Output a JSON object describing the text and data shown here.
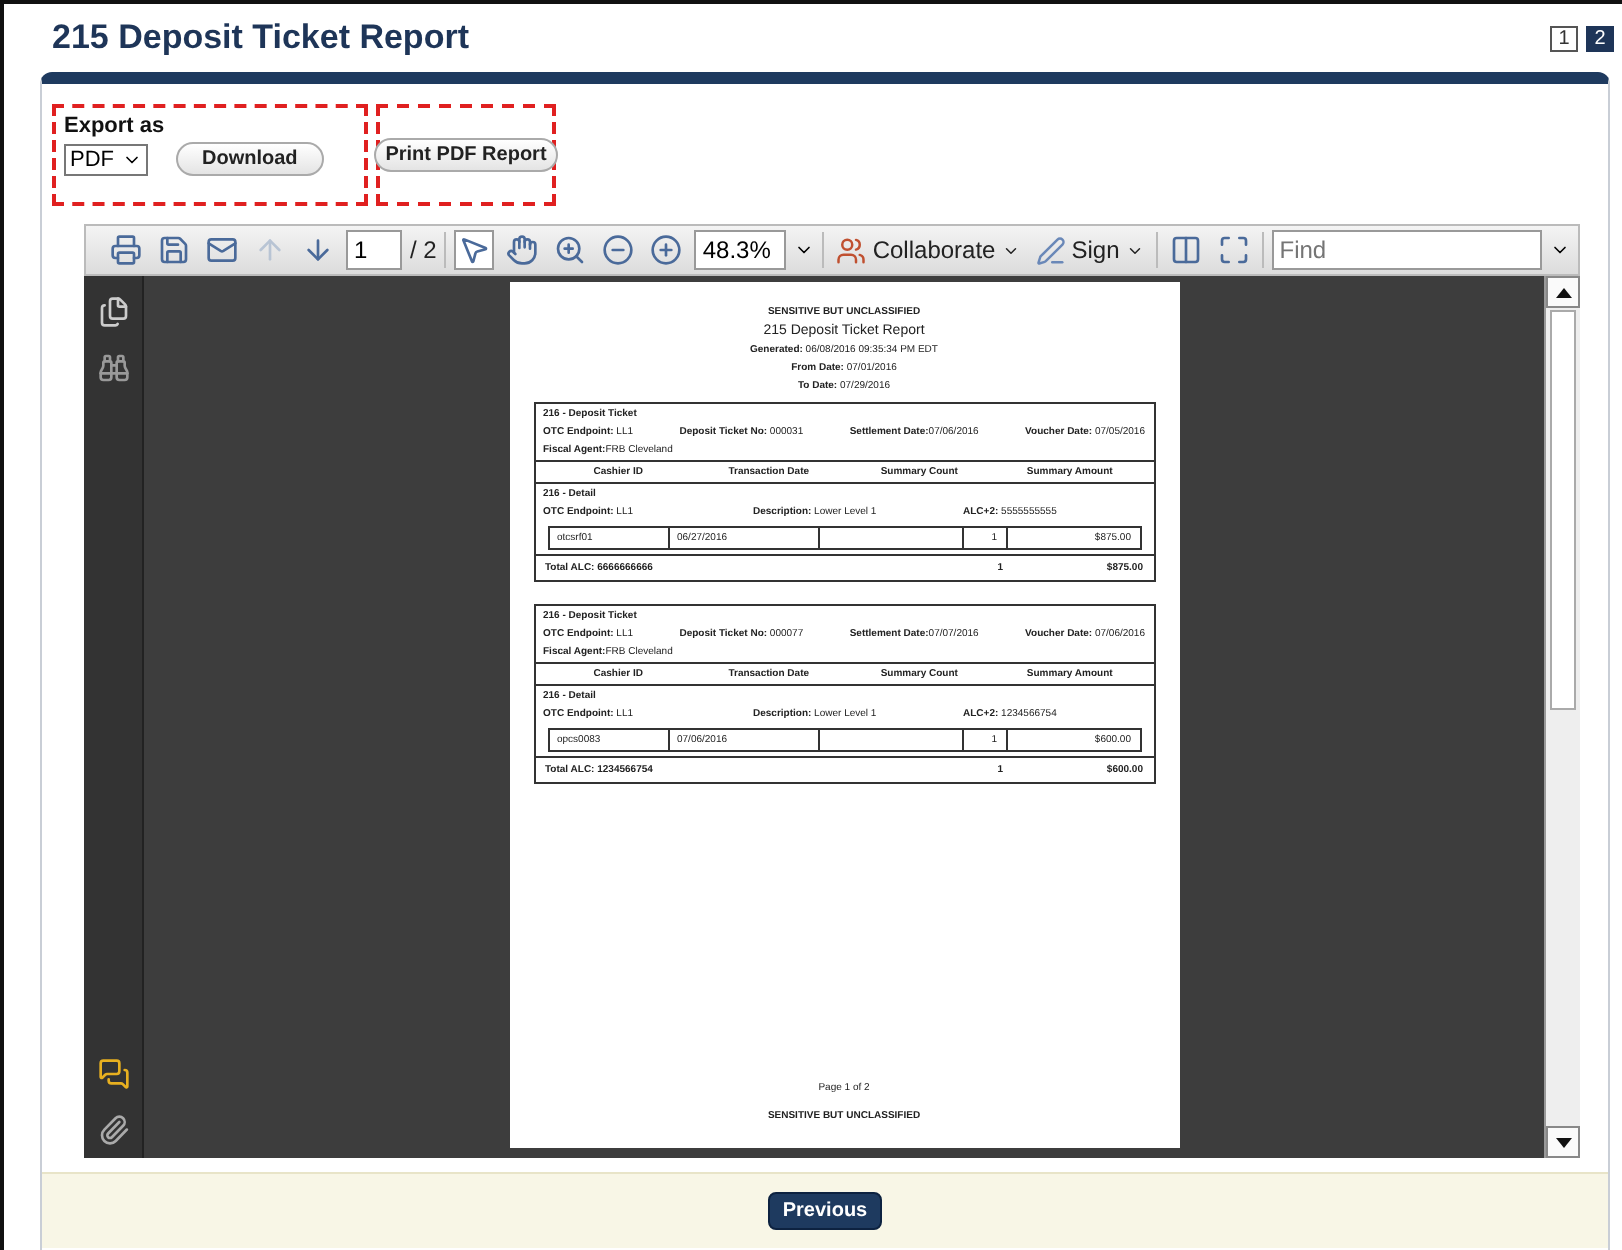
{
  "title": "215 Deposit Ticket Report",
  "pager": [
    {
      "label": "1",
      "selected": false
    },
    {
      "label": "2",
      "selected": true
    }
  ],
  "export": {
    "label": "Export as",
    "format": "PDF",
    "download": "Download",
    "print": "Print PDF Report"
  },
  "toolbar": {
    "tools": [
      {
        "kind": "print",
        "disabled": false
      },
      {
        "kind": "save",
        "disabled": false
      },
      {
        "kind": "email",
        "disabled": false
      },
      {
        "kind": "prev",
        "disabled": true
      },
      {
        "kind": "next",
        "disabled": false
      }
    ],
    "page": "1",
    "page_total": "/ 2",
    "view_tools": [
      {
        "kind": "select",
        "selected": true
      },
      {
        "kind": "hand",
        "selected": false
      },
      {
        "kind": "marquee",
        "selected": false
      },
      {
        "kind": "zoomout",
        "selected": false
      },
      {
        "kind": "zoomin",
        "selected": false
      }
    ],
    "zoom": "48.3%",
    "collaborate": "Collaborate",
    "sign": "Sign",
    "find_placeholder": "Find"
  },
  "sidebar": [
    {
      "kind": "pages"
    },
    {
      "kind": "binoculars"
    },
    {
      "kind": "comments"
    },
    {
      "kind": "attach"
    }
  ],
  "document": {
    "banner": "SENSITIVE BUT UNCLASSIFIED",
    "title": "215 Deposit Ticket Report",
    "header_lines": [
      "**Generated:** 06/08/2016 09:35:34 PM EDT",
      "**From Date:** 07/01/2016",
      "**To Date:** 07/29/2016"
    ],
    "tickets": [
      {
        "heading": "216 - Deposit Ticket",
        "fields": [
          "**OTC Endpoint:** LL1",
          "**Deposit Ticket No:** 000031",
          "**Settlement Date:**07/06/2016",
          "**Voucher Date:** 07/05/2016"
        ],
        "agent": "**Fiscal Agent:**FRB Cleveland",
        "columns": [
          "Cashier ID",
          "Transaction Date",
          "Summary Count",
          "Summary Amount"
        ],
        "detail": "216 - Detail",
        "detail_fields": [
          "**OTC Endpoint:** LL1",
          "**Description:** Lower Level 1",
          "**ALC+2:** 5555555555"
        ],
        "row": [
          "otcsrf01",
          "06/27/2016",
          "1",
          "$875.00"
        ],
        "total": [
          "Total ALC:  6666666666",
          "1",
          "$875.00"
        ]
      },
      {
        "heading": "216 - Deposit Ticket",
        "fields": [
          "**OTC Endpoint:** LL1",
          "**Deposit Ticket No:** 000077",
          "**Settlement Date:**07/07/2016",
          "**Voucher Date:** 07/06/2016"
        ],
        "agent": "**Fiscal Agent:**FRB Cleveland",
        "columns": [
          "Cashier ID",
          "Transaction Date",
          "Summary Count",
          "Summary Amount"
        ],
        "detail": "216 - Detail",
        "detail_fields": [
          "**OTC Endpoint:** LL1",
          "**Description:** Lower Level 1",
          "**ALC+2:** 1234566754"
        ],
        "row": [
          "opcs0083",
          "07/06/2016",
          "1",
          "$600.00"
        ],
        "total": [
          "Total ALC:  1234566754",
          "1",
          "$600.00"
        ]
      }
    ],
    "page_label": "Page 1 of 2",
    "footer_banner": "SENSITIVE BUT UNCLASSIFIED"
  },
  "previous": "Previous"
}
